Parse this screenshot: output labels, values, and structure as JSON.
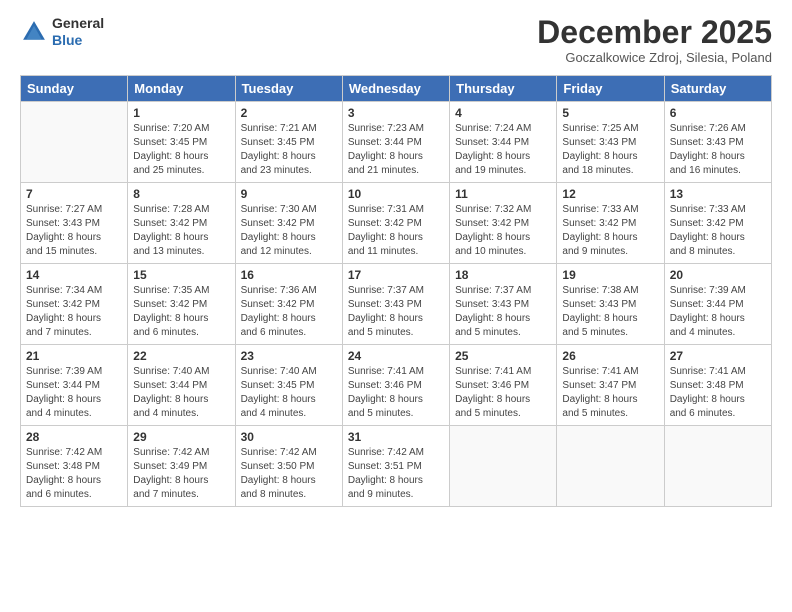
{
  "logo": {
    "line1": "General",
    "line2": "Blue"
  },
  "header": {
    "month": "December 2025",
    "location": "Goczalkowice Zdroj, Silesia, Poland"
  },
  "weekdays": [
    "Sunday",
    "Monday",
    "Tuesday",
    "Wednesday",
    "Thursday",
    "Friday",
    "Saturday"
  ],
  "weeks": [
    [
      {
        "day": "",
        "info": ""
      },
      {
        "day": "1",
        "info": "Sunrise: 7:20 AM\nSunset: 3:45 PM\nDaylight: 8 hours\nand 25 minutes."
      },
      {
        "day": "2",
        "info": "Sunrise: 7:21 AM\nSunset: 3:45 PM\nDaylight: 8 hours\nand 23 minutes."
      },
      {
        "day": "3",
        "info": "Sunrise: 7:23 AM\nSunset: 3:44 PM\nDaylight: 8 hours\nand 21 minutes."
      },
      {
        "day": "4",
        "info": "Sunrise: 7:24 AM\nSunset: 3:44 PM\nDaylight: 8 hours\nand 19 minutes."
      },
      {
        "day": "5",
        "info": "Sunrise: 7:25 AM\nSunset: 3:43 PM\nDaylight: 8 hours\nand 18 minutes."
      },
      {
        "day": "6",
        "info": "Sunrise: 7:26 AM\nSunset: 3:43 PM\nDaylight: 8 hours\nand 16 minutes."
      }
    ],
    [
      {
        "day": "7",
        "info": "Sunrise: 7:27 AM\nSunset: 3:43 PM\nDaylight: 8 hours\nand 15 minutes."
      },
      {
        "day": "8",
        "info": "Sunrise: 7:28 AM\nSunset: 3:42 PM\nDaylight: 8 hours\nand 13 minutes."
      },
      {
        "day": "9",
        "info": "Sunrise: 7:30 AM\nSunset: 3:42 PM\nDaylight: 8 hours\nand 12 minutes."
      },
      {
        "day": "10",
        "info": "Sunrise: 7:31 AM\nSunset: 3:42 PM\nDaylight: 8 hours\nand 11 minutes."
      },
      {
        "day": "11",
        "info": "Sunrise: 7:32 AM\nSunset: 3:42 PM\nDaylight: 8 hours\nand 10 minutes."
      },
      {
        "day": "12",
        "info": "Sunrise: 7:33 AM\nSunset: 3:42 PM\nDaylight: 8 hours\nand 9 minutes."
      },
      {
        "day": "13",
        "info": "Sunrise: 7:33 AM\nSunset: 3:42 PM\nDaylight: 8 hours\nand 8 minutes."
      }
    ],
    [
      {
        "day": "14",
        "info": "Sunrise: 7:34 AM\nSunset: 3:42 PM\nDaylight: 8 hours\nand 7 minutes."
      },
      {
        "day": "15",
        "info": "Sunrise: 7:35 AM\nSunset: 3:42 PM\nDaylight: 8 hours\nand 6 minutes."
      },
      {
        "day": "16",
        "info": "Sunrise: 7:36 AM\nSunset: 3:42 PM\nDaylight: 8 hours\nand 6 minutes."
      },
      {
        "day": "17",
        "info": "Sunrise: 7:37 AM\nSunset: 3:43 PM\nDaylight: 8 hours\nand 5 minutes."
      },
      {
        "day": "18",
        "info": "Sunrise: 7:37 AM\nSunset: 3:43 PM\nDaylight: 8 hours\nand 5 minutes."
      },
      {
        "day": "19",
        "info": "Sunrise: 7:38 AM\nSunset: 3:43 PM\nDaylight: 8 hours\nand 5 minutes."
      },
      {
        "day": "20",
        "info": "Sunrise: 7:39 AM\nSunset: 3:44 PM\nDaylight: 8 hours\nand 4 minutes."
      }
    ],
    [
      {
        "day": "21",
        "info": "Sunrise: 7:39 AM\nSunset: 3:44 PM\nDaylight: 8 hours\nand 4 minutes."
      },
      {
        "day": "22",
        "info": "Sunrise: 7:40 AM\nSunset: 3:44 PM\nDaylight: 8 hours\nand 4 minutes."
      },
      {
        "day": "23",
        "info": "Sunrise: 7:40 AM\nSunset: 3:45 PM\nDaylight: 8 hours\nand 4 minutes."
      },
      {
        "day": "24",
        "info": "Sunrise: 7:41 AM\nSunset: 3:46 PM\nDaylight: 8 hours\nand 5 minutes."
      },
      {
        "day": "25",
        "info": "Sunrise: 7:41 AM\nSunset: 3:46 PM\nDaylight: 8 hours\nand 5 minutes."
      },
      {
        "day": "26",
        "info": "Sunrise: 7:41 AM\nSunset: 3:47 PM\nDaylight: 8 hours\nand 5 minutes."
      },
      {
        "day": "27",
        "info": "Sunrise: 7:41 AM\nSunset: 3:48 PM\nDaylight: 8 hours\nand 6 minutes."
      }
    ],
    [
      {
        "day": "28",
        "info": "Sunrise: 7:42 AM\nSunset: 3:48 PM\nDaylight: 8 hours\nand 6 minutes."
      },
      {
        "day": "29",
        "info": "Sunrise: 7:42 AM\nSunset: 3:49 PM\nDaylight: 8 hours\nand 7 minutes."
      },
      {
        "day": "30",
        "info": "Sunrise: 7:42 AM\nSunset: 3:50 PM\nDaylight: 8 hours\nand 8 minutes."
      },
      {
        "day": "31",
        "info": "Sunrise: 7:42 AM\nSunset: 3:51 PM\nDaylight: 8 hours\nand 9 minutes."
      },
      {
        "day": "",
        "info": ""
      },
      {
        "day": "",
        "info": ""
      },
      {
        "day": "",
        "info": ""
      }
    ]
  ]
}
